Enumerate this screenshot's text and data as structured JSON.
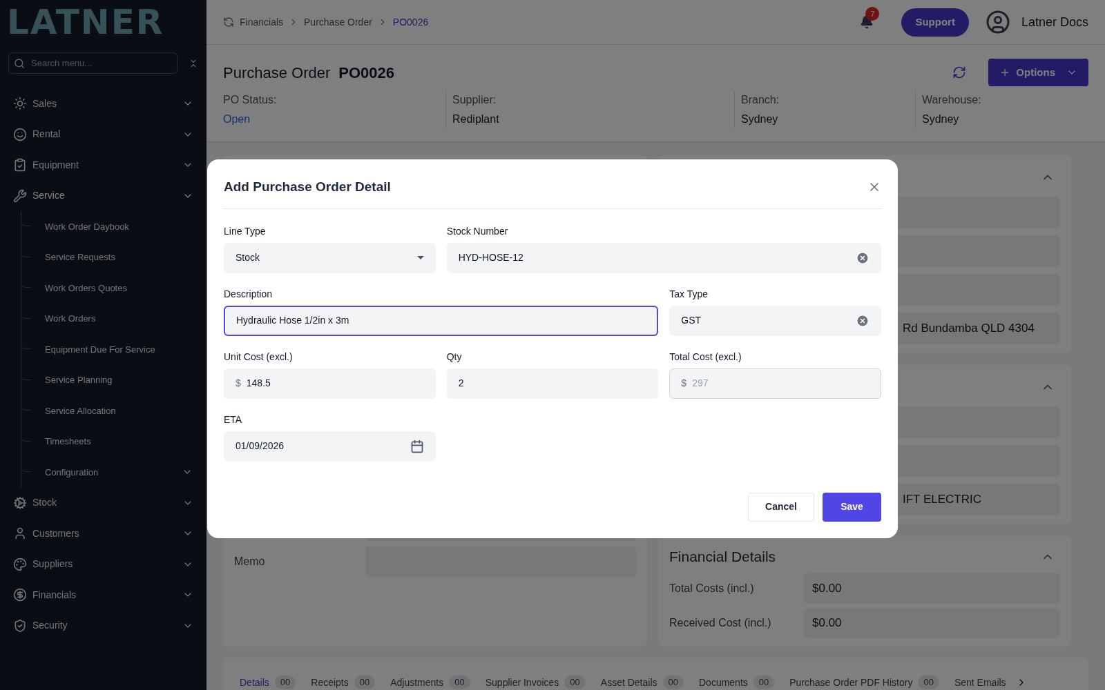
{
  "sidebar": {
    "logo": "LATNER",
    "search": {
      "placeholder": "Search menu..."
    },
    "menu": [
      {
        "label": "Sales",
        "expanded": false
      },
      {
        "label": "Rental",
        "expanded": false
      },
      {
        "label": "Equipment",
        "expanded": false
      },
      {
        "label": "Service",
        "expanded": true,
        "children": [
          {
            "label": "Work Order Daybook"
          },
          {
            "label": "Service Requests"
          },
          {
            "label": "Work Orders Quotes"
          },
          {
            "label": "Work Orders"
          },
          {
            "label": "Equipment Due For Service"
          },
          {
            "label": "Service Planning"
          },
          {
            "label": "Service Allocation"
          },
          {
            "label": "Timesheets"
          },
          {
            "label": "Configuration",
            "has_submenu": true
          }
        ]
      },
      {
        "label": "Stock",
        "expanded": false
      },
      {
        "label": "Customers",
        "expanded": false
      },
      {
        "label": "Suppliers",
        "expanded": false
      },
      {
        "label": "Financials",
        "expanded": false
      },
      {
        "label": "Security",
        "expanded": false
      }
    ]
  },
  "header": {
    "breadcrumbs": [
      {
        "label": "Financials",
        "selected": false
      },
      {
        "label": "Purchase Order",
        "selected": false
      },
      {
        "label": "PO0026",
        "selected": true
      }
    ],
    "notification_count": "7",
    "support": "Support",
    "user": "Latner Docs"
  },
  "page": {
    "title": "Purchase Order",
    "number": "PO0026",
    "options": "Options",
    "info": [
      {
        "label": "PO Status:",
        "value": "Open",
        "kind": "status"
      },
      {
        "label": "Supplier:",
        "value": "Rediplant",
        "kind": "plain"
      },
      {
        "label": "Branch:",
        "value": "Sydney",
        "kind": "plain"
      },
      {
        "label": "Warehouse:",
        "value": "Sydney",
        "kind": "plain"
      }
    ],
    "left_card": {
      "rows": [
        {
          "kind": "blank"
        },
        {
          "kind": "labelled",
          "label": "Memo"
        }
      ]
    },
    "right_cards": [
      {
        "fields": [
          {
            "kind": "blank"
          },
          {
            "kind": "blank"
          },
          {
            "kind": "blank"
          },
          {
            "kind": "text",
            "value": "Rd Bundamba QLD 4304"
          }
        ]
      },
      {
        "fields": [
          {
            "kind": "blank"
          },
          {
            "kind": "blank"
          },
          {
            "kind": "text",
            "value": "IFT ELECTRIC"
          }
        ]
      }
    ],
    "financial": {
      "title": "Financial Details",
      "rows": [
        {
          "label": "Total Costs (incl.)",
          "value": "$0.00"
        },
        {
          "label": "Received Cost (incl.)",
          "value": "$0.00"
        }
      ]
    },
    "tabs": [
      {
        "label": "Details",
        "count": "00",
        "selected": true
      },
      {
        "label": "Receipts",
        "count": "00",
        "selected": false
      },
      {
        "label": "Adjustments",
        "count": "00",
        "selected": false
      },
      {
        "label": "Supplier Invoices",
        "count": "00",
        "selected": false
      },
      {
        "label": "Asset Details",
        "count": "00",
        "selected": false
      },
      {
        "label": "Documents",
        "count": "00",
        "selected": false
      },
      {
        "label": "Purchase Order PDF History",
        "count": "00",
        "selected": false
      },
      {
        "label": "Sent Emails",
        "selected": false
      }
    ]
  },
  "modal": {
    "title": "Add Purchase Order Detail",
    "fields": [
      {
        "label": "Line Type",
        "value": "Stock",
        "kind": "select"
      },
      {
        "label": "Stock Number",
        "value": "HYD-HOSE-12",
        "kind": "clearable",
        "wide": true
      },
      {
        "label": "Description",
        "value": "Hydraulic Hose 1/2in x 3m",
        "kind": "text",
        "wide": true,
        "focused": true
      },
      {
        "label": "Tax Type",
        "value": "GST",
        "kind": "clearable"
      },
      {
        "label": "Unit Cost (excl.)",
        "prefix": "$",
        "value": "148.5",
        "kind": "currency"
      },
      {
        "label": "Qty",
        "value": "2",
        "kind": "text"
      },
      {
        "label": "Total Cost (excl.)",
        "prefix": "$",
        "value": "297",
        "kind": "currency",
        "disabled": true
      },
      {
        "label": "ETA",
        "value": "01/09/2026",
        "kind": "date"
      }
    ],
    "buttons": [
      {
        "label": "Cancel",
        "kind": "secondary"
      },
      {
        "label": "Save",
        "kind": "primary"
      }
    ]
  }
}
